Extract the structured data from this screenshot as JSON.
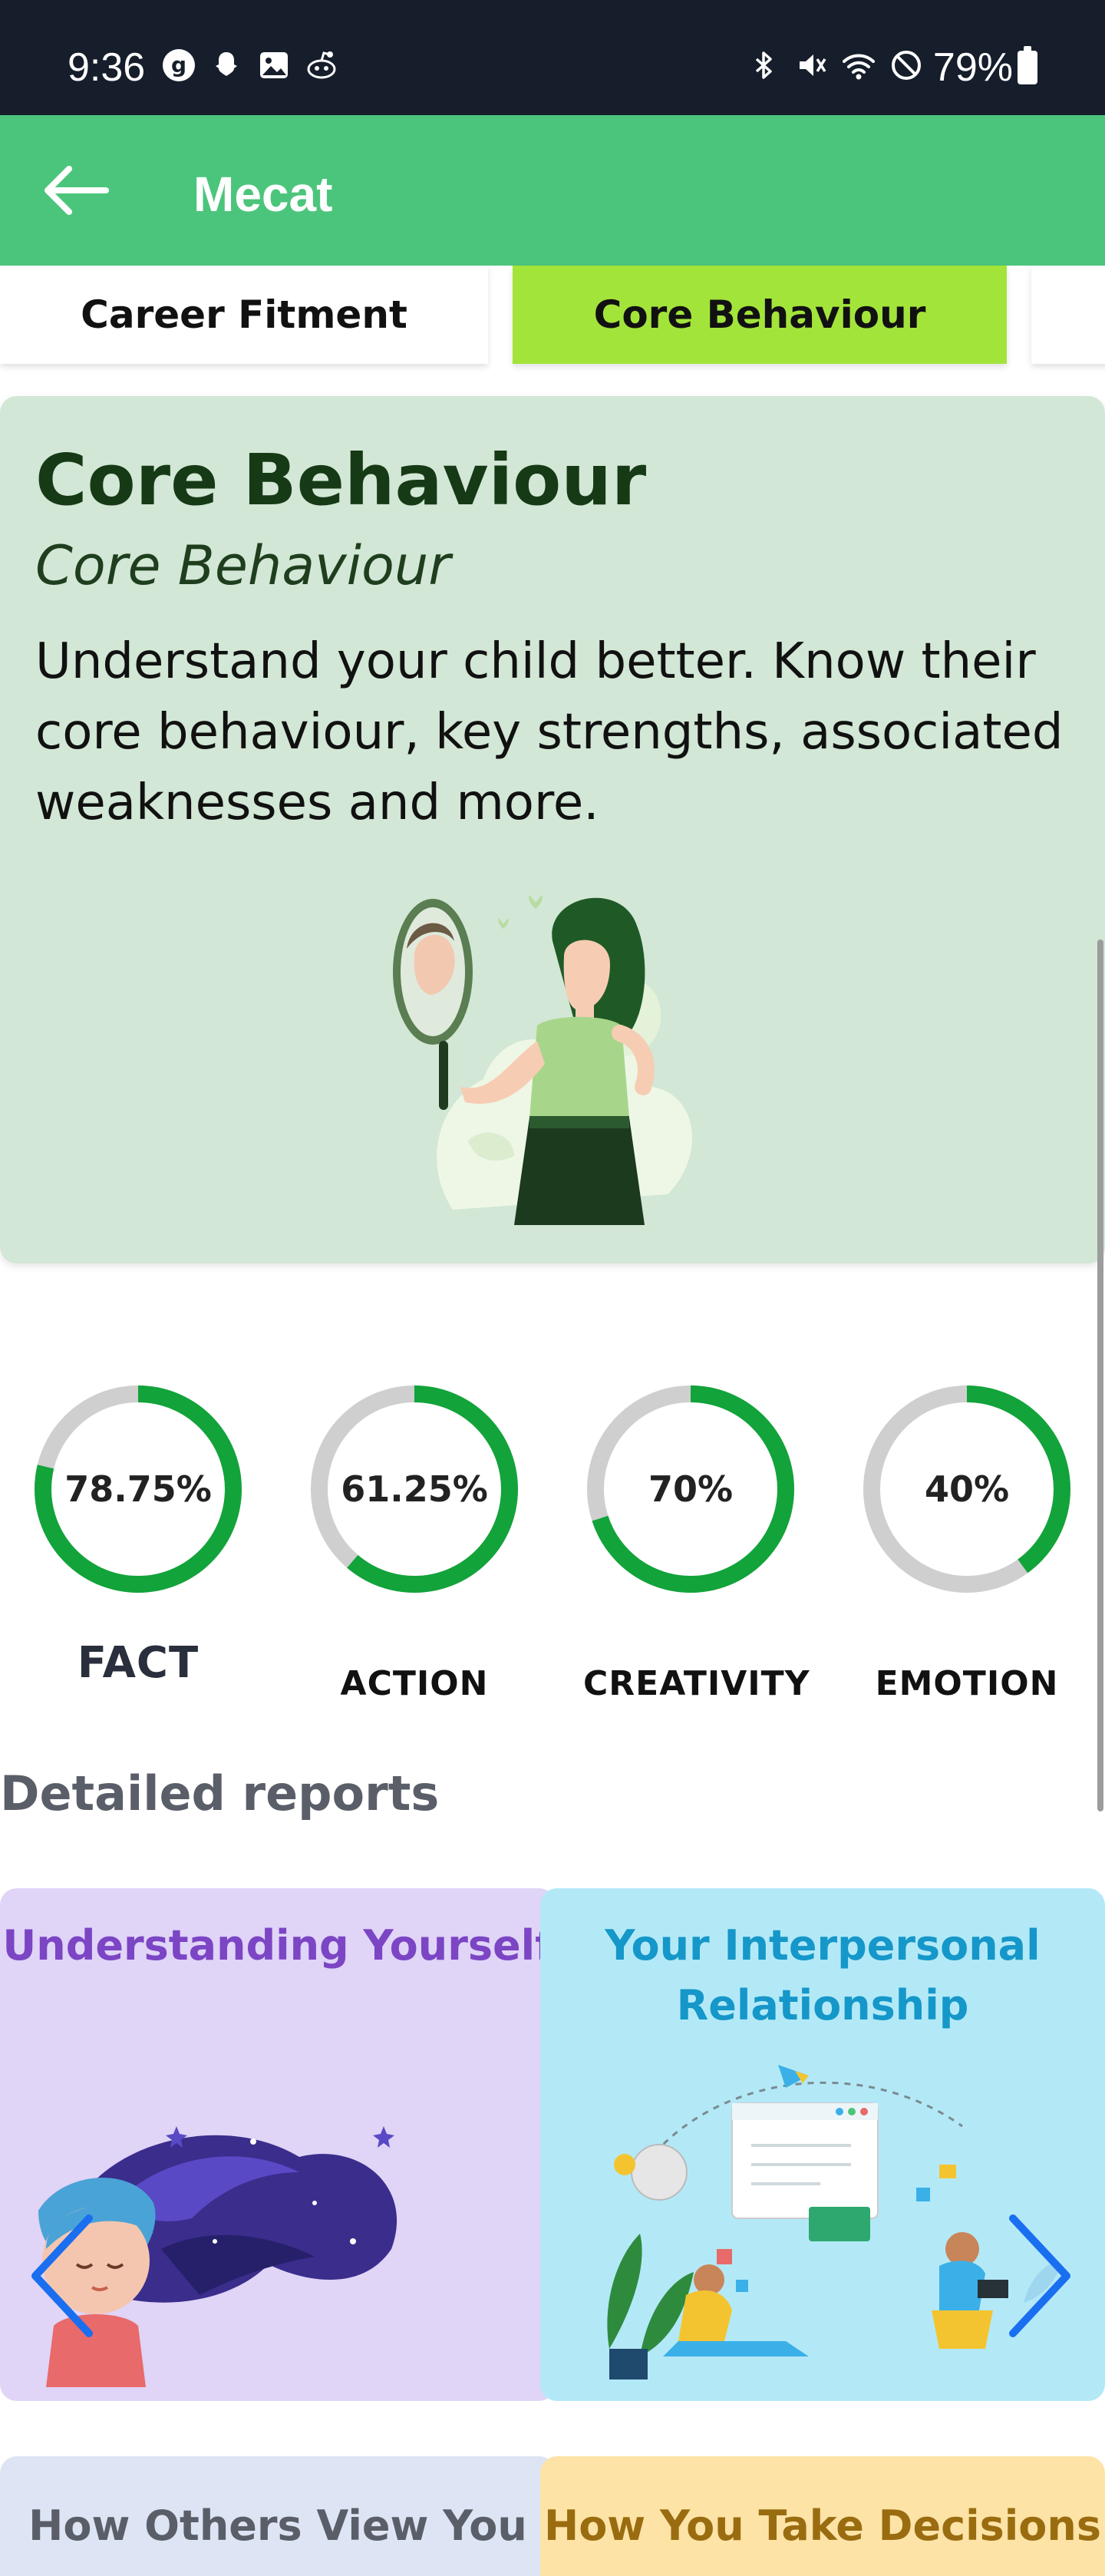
{
  "status_bar": {
    "time": "9:36",
    "battery": "79%"
  },
  "app_bar": {
    "title": "Mecat"
  },
  "tabs": [
    {
      "label": "Career Fitment",
      "active": false
    },
    {
      "label": "Core Behaviour",
      "active": true
    },
    {
      "label": "",
      "active": false
    }
  ],
  "hero": {
    "title": "Core Behaviour",
    "subtitle": "Core Behaviour",
    "description": "Understand your child better. Know their core behaviour, key strengths, associated weaknesses and more."
  },
  "scores": [
    {
      "label": "FACT",
      "value_text": "78.75%",
      "value": 78.75
    },
    {
      "label": "ACTION",
      "value_text": "61.25%",
      "value": 61.25
    },
    {
      "label": "CREATIVITY",
      "value_text": "70%",
      "value": 70
    },
    {
      "label": "EMOTION",
      "value_text": "40%",
      "value": 40
    }
  ],
  "detailed_reports": {
    "title": "Detailed reports",
    "cards": [
      {
        "title": "Understanding Yourself"
      },
      {
        "title": "Your Interpersonal Relationship"
      },
      {
        "title": "How Others View You"
      },
      {
        "title": "How You Take Decisions"
      }
    ]
  },
  "colors": {
    "app_bar": "#4cc57c",
    "active_tab": "#a3e43a",
    "hero_bg": "#d2e7d5",
    "ring_progress": "#12a33a",
    "ring_track": "#cfcfcf"
  }
}
